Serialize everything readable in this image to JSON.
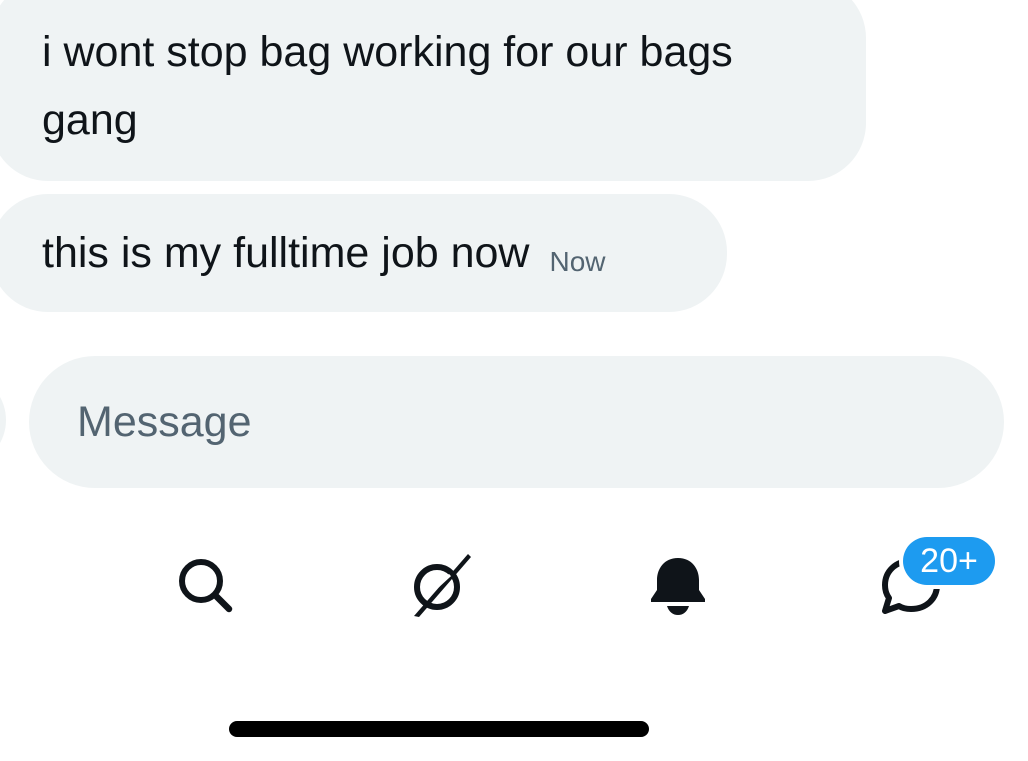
{
  "messages": [
    {
      "text": "i wont stop bag working for our bags gang",
      "timestamp": ""
    },
    {
      "text": "this is my fulltime job now",
      "timestamp": "Now"
    }
  ],
  "composer": {
    "placeholder": "Message",
    "value": ""
  },
  "tab_bar": {
    "items": [
      {
        "icon": "search-icon"
      },
      {
        "icon": "grok-icon"
      },
      {
        "icon": "bell-icon"
      },
      {
        "icon": "messages-icon",
        "badge": "20+"
      }
    ]
  },
  "colors": {
    "bubble_background": "#eff3f4",
    "text": "#0f1419",
    "secondary_text": "#536471",
    "badge": "#1d9bf0"
  }
}
